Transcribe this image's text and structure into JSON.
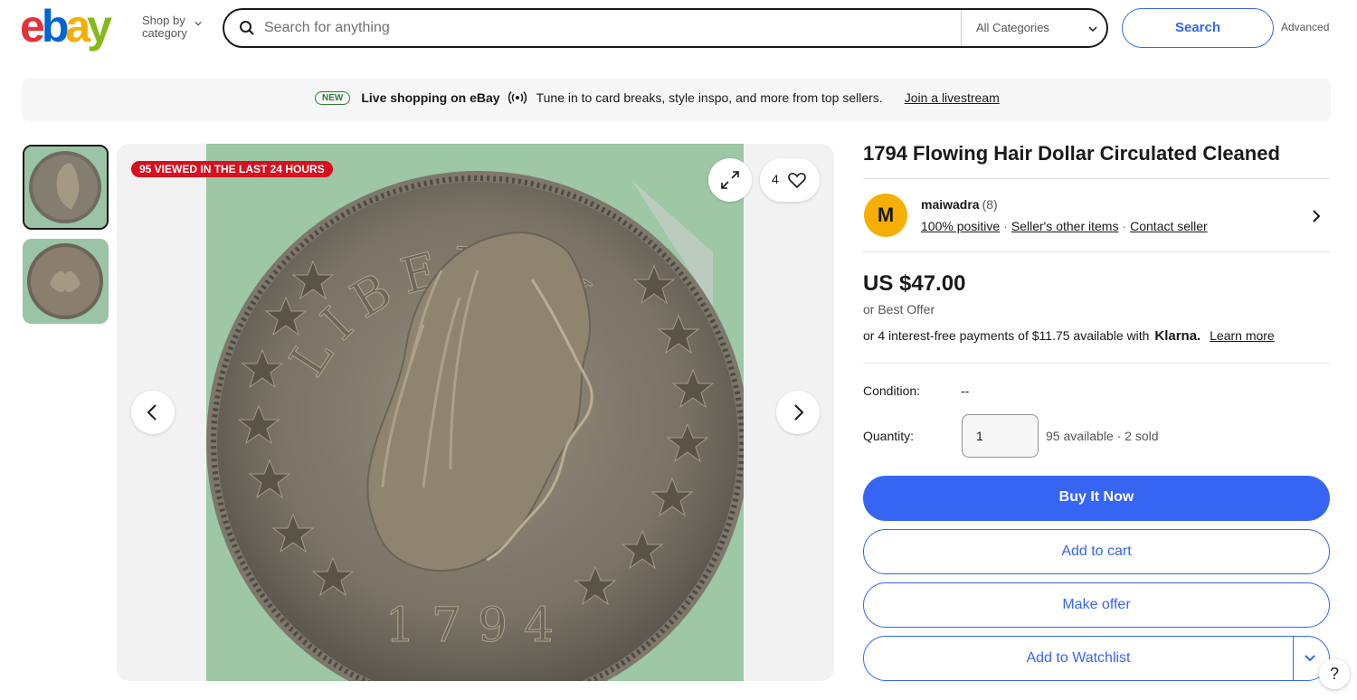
{
  "header": {
    "logo_letters": [
      "e",
      "b",
      "a",
      "y"
    ],
    "logo_colors": [
      "#e53238",
      "#0064d2",
      "#f5af02",
      "#86b817"
    ],
    "shop_by_line1": "Shop by",
    "shop_by_line2": "category",
    "search_placeholder": "Search for anything",
    "category_selected": "All Categories",
    "search_button": "Search",
    "advanced_link": "Advanced"
  },
  "banner": {
    "badge": "NEW",
    "title": "Live shopping on eBay",
    "text": "Tune in to card breaks, style inspo, and more from top sellers.",
    "link": "Join a livestream"
  },
  "gallery": {
    "viewed_badge": "95 VIEWED IN THE LAST 24 HOURS",
    "watch_count": "4",
    "coin_legend": "LIBERTY",
    "coin_year": "1794",
    "thumbnails": [
      "obverse",
      "reverse"
    ]
  },
  "item": {
    "title": "1794 Flowing Hair Dollar Circulated Cleaned",
    "seller": {
      "initial": "M",
      "name": "maiwadra",
      "feedback_count": "(8)",
      "positive": "100% positive",
      "other_items": "Seller's other items",
      "contact": "Contact seller"
    },
    "price": "US $47.00",
    "best_offer": "or Best Offer",
    "klarna_text": "or 4 interest-free payments of $11.75 available with",
    "klarna_brand": "Klarna.",
    "klarna_link": "Learn more",
    "condition_label": "Condition:",
    "condition_value": "--",
    "quantity_label": "Quantity:",
    "quantity_value": "1",
    "availability": "95 available · 2 sold",
    "buttons": {
      "buy_now": "Buy It Now",
      "add_to_cart": "Add to cart",
      "make_offer": "Make offer",
      "watchlist": "Add to Watchlist"
    }
  },
  "help": "?",
  "colors": {
    "accent": "#3665f3",
    "badge_red": "#d80f1f",
    "coin_bg": "#9dc7a5"
  }
}
